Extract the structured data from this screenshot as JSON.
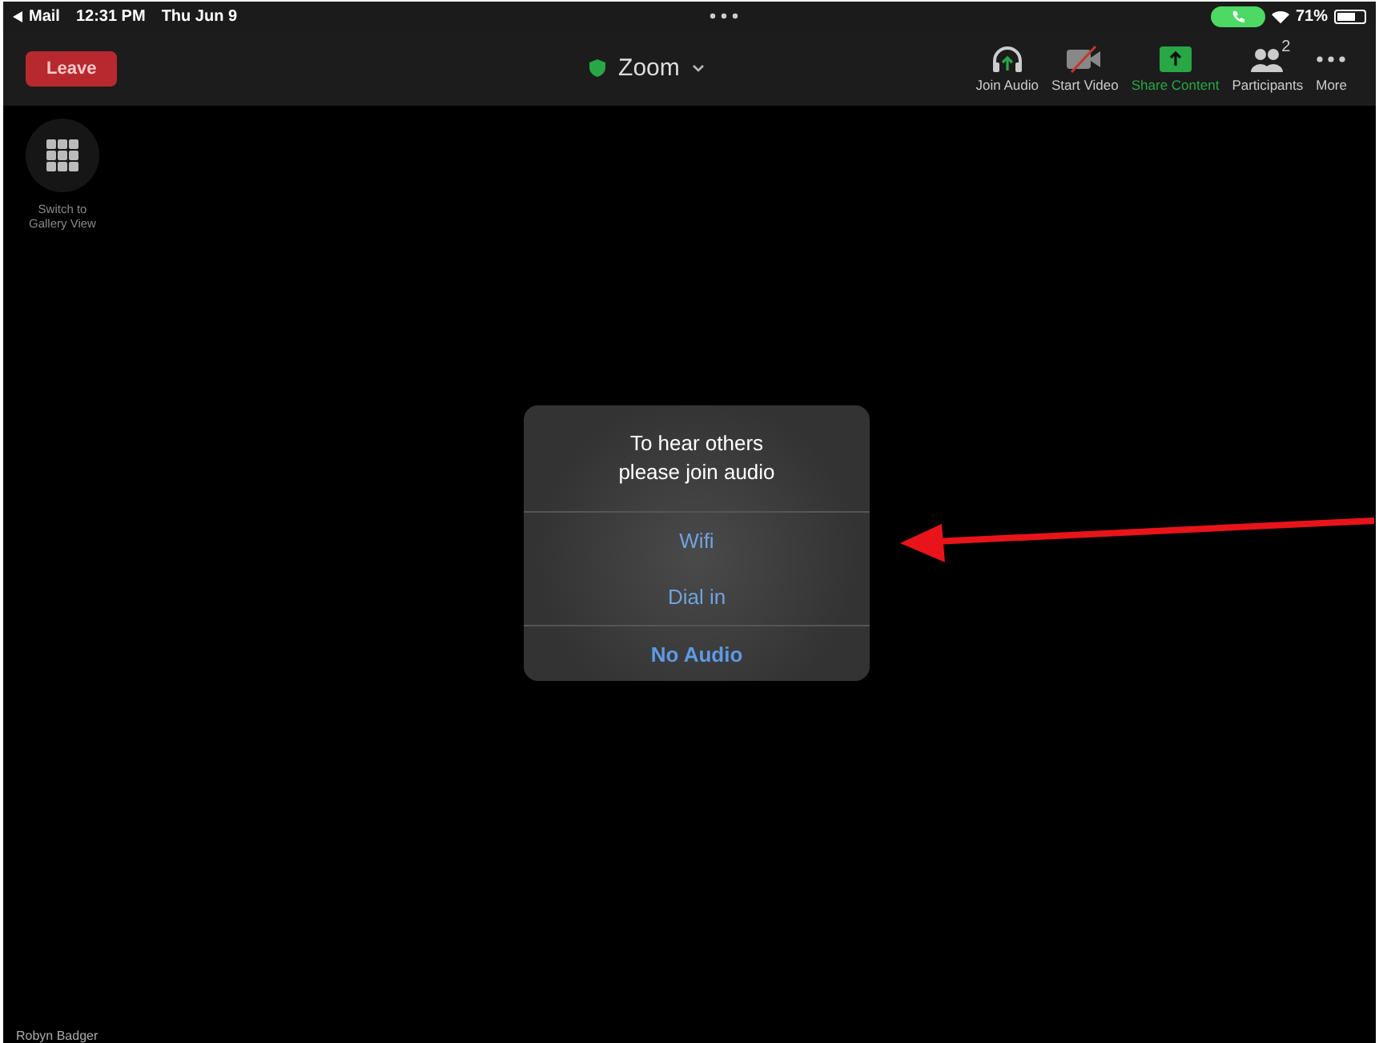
{
  "status_bar": {
    "back_app": "Mail",
    "time": "12:31 PM",
    "date": "Thu Jun 9",
    "battery": "71%"
  },
  "toolbar": {
    "leave": "Leave",
    "meeting_title": "Zoom",
    "items": [
      {
        "kind": "audio",
        "label": "Join Audio",
        "highlighted": false
      },
      {
        "kind": "video",
        "label": "Start Video",
        "highlighted": false
      },
      {
        "kind": "share",
        "label": "Share Content",
        "highlighted": true
      },
      {
        "kind": "participants",
        "label": "Participants",
        "highlighted": false,
        "count": "2"
      },
      {
        "kind": "more",
        "label": "More",
        "highlighted": false
      }
    ]
  },
  "gallery_button": {
    "label": "Switch to Gallery View"
  },
  "dialog": {
    "title": "To hear others please join audio",
    "options": [
      {
        "kind": "option",
        "label": "Wifi"
      },
      {
        "kind": "option",
        "label": "Dial in"
      },
      {
        "kind": "cancel",
        "label": "No Audio"
      }
    ]
  },
  "participant_name": "Robyn Badger"
}
